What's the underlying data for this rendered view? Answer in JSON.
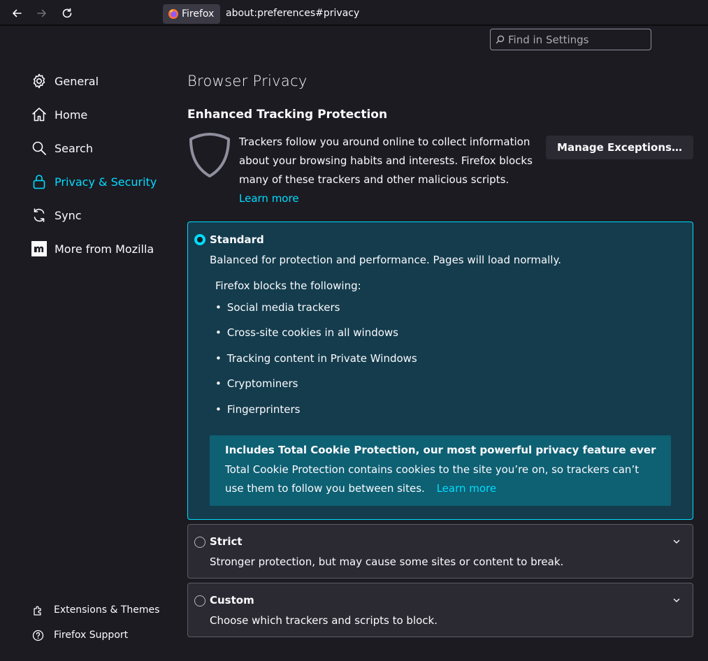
{
  "toolbar": {
    "identity_label": "Firefox",
    "url": "about:preferences#privacy"
  },
  "search": {
    "placeholder": "Find in Settings"
  },
  "sidebar": {
    "items": [
      {
        "label": "General",
        "icon": "gear-icon"
      },
      {
        "label": "Home",
        "icon": "home-icon"
      },
      {
        "label": "Search",
        "icon": "search-icon"
      },
      {
        "label": "Privacy & Security",
        "icon": "lock-icon",
        "active": true
      },
      {
        "label": "Sync",
        "icon": "sync-icon"
      },
      {
        "label": "More from Mozilla",
        "icon": "mozilla-icon"
      }
    ],
    "bottom": [
      {
        "label": "Extensions & Themes",
        "icon": "puzzle-icon"
      },
      {
        "label": "Firefox Support",
        "icon": "help-icon"
      }
    ]
  },
  "main": {
    "page_title": "Browser Privacy",
    "etp": {
      "title": "Enhanced Tracking Protection",
      "description": "Trackers follow you around online to collect information about your browsing habits and interests. Firefox blocks many of these trackers and other malicious scripts.",
      "learn_more": "Learn more",
      "manage_button": "Manage Exceptions…"
    },
    "options": {
      "standard": {
        "label": "Standard",
        "description": "Balanced for protection and performance. Pages will load normally.",
        "blocks_label": "Firefox blocks the following:",
        "blocks": [
          "Social media trackers",
          "Cross-site cookies in all windows",
          "Tracking content in Private Windows",
          "Cryptominers",
          "Fingerprinters"
        ],
        "tcp_title": "Includes Total Cookie Protection, our most powerful privacy feature ever",
        "tcp_body": "Total Cookie Protection contains cookies to the site you’re on, so trackers can’t use them to follow you between sites.",
        "tcp_learn_more": "Learn more"
      },
      "strict": {
        "label": "Strict",
        "description": "Stronger protection, but may cause some sites or content to break."
      },
      "custom": {
        "label": "Custom",
        "description": "Choose which trackers and scripts to block."
      }
    }
  },
  "colors": {
    "background": "#1c1b22",
    "accent": "#00ddff",
    "standard_card": "#143c4d",
    "tcp_box": "#0e6073",
    "card": "#2b2a33"
  }
}
